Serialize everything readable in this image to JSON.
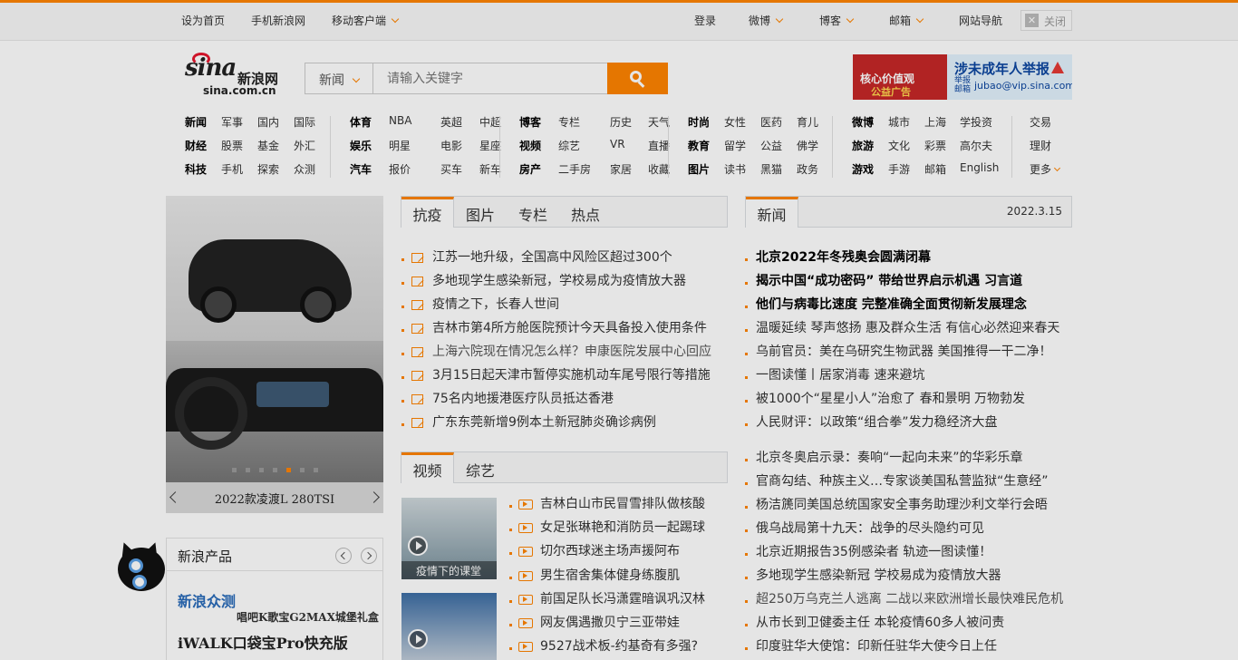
{
  "topbar": {
    "left_links": [
      "设为首页",
      "手机新浪网",
      "移动客户端"
    ],
    "right_links": [
      "登录",
      "微博",
      "博客",
      "邮箱",
      "网站导航"
    ],
    "close_label": "关闭"
  },
  "logo": {
    "brand": "sina",
    "cn": "新浪网",
    "domain": "sina.com.cn"
  },
  "search": {
    "category": "新闻",
    "placeholder": "请输入关键字"
  },
  "ad": {
    "left_line1": "核心价值观",
    "left_line2": "公益广告",
    "right_title": "涉未成年人举报",
    "right_small": "举报邮箱",
    "right_email": "jubao@vip.sina.com"
  },
  "nav": [
    [
      [
        "新闻",
        "军事",
        "国内",
        "国际"
      ],
      [
        "财经",
        "股票",
        "基金",
        "外汇"
      ],
      [
        "科技",
        "手机",
        "探索",
        "众测"
      ]
    ],
    [
      [
        "体育",
        "NBA",
        "英超",
        "中超"
      ],
      [
        "娱乐",
        "明星",
        "电影",
        "星座"
      ],
      [
        "汽车",
        "报价",
        "买车",
        "新车"
      ]
    ],
    [
      [
        "博客",
        "专栏",
        "历史",
        "天气"
      ],
      [
        "视频",
        "综艺",
        "VR",
        "直播"
      ],
      [
        "房产",
        "二手房",
        "家居",
        "收藏"
      ]
    ],
    [
      [
        "时尚",
        "女性",
        "医药",
        "育儿"
      ],
      [
        "教育",
        "留学",
        "公益",
        "佛学"
      ],
      [
        "图片",
        "读书",
        "黑猫",
        "政务"
      ]
    ],
    [
      [
        "微博",
        "城市",
        "上海",
        "学投资"
      ],
      [
        "旅游",
        "文化",
        "彩票",
        "高尔夫"
      ],
      [
        "游戏",
        "手游",
        "邮箱",
        "English"
      ]
    ],
    [
      [
        "交易"
      ],
      [
        "理财"
      ],
      [
        "更多"
      ]
    ]
  ],
  "carousel": {
    "caption": "2022款凌渡L 280TSI",
    "dot_count": 7,
    "active_dot": 5
  },
  "products": {
    "title": "新浪产品",
    "item1": "新浪众测",
    "item2": "唱吧K歌宝G2MAX城堡礼盒",
    "item3": "iWALK口袋宝Pro快充版"
  },
  "tabs_mid": [
    "抗疫",
    "图片",
    "专栏",
    "热点"
  ],
  "news_mid": [
    "江苏一地升级，全国高中风险区超过300个",
    "多地现学生感染新冠，学校易成为疫情放大器",
    "疫情之下，长春人世间",
    "吉林市第4所方舱医院预计今天具备投入使用条件",
    "上海六院现在情况怎么样？申康医院发展中心回应",
    "3月15日起天津市暂停实施机动车尾号限行等措施",
    "75名内地援港医疗队员抵达香港",
    "广东东莞新增9例本土新冠肺炎确诊病例"
  ],
  "tabs_video": [
    "视频",
    "综艺"
  ],
  "video_caption": "疫情下的课堂",
  "news_video": [
    "吉林白山市民冒雪排队做核酸",
    "女足张琳艳和消防员一起踢球",
    "切尔西球迷主场声援阿布",
    "男生宿舍集体健身练腹肌",
    "前国足队长冯潇霆暗讽巩汉林",
    "网友偶遇撒贝宁三亚带娃",
    "9527战术板-约基奇有多强?"
  ],
  "news_tab": "新闻",
  "news_date": "2022.3.15",
  "news_right_top": [
    "北京2022年冬残奥会圆满闭幕",
    "揭示中国“成功密码” 带给世界启示机遇 习言道",
    "他们与病毒比速度 完整准确全面贯彻新发展理念",
    "温暖延续 琴声悠扬 惠及群众生活 有信心必然迎来春天",
    "乌前官员：美在乌研究生物武器 美国推得一干二净！",
    "一图读懂丨居家消毒 速来避坑",
    "被1000个“星星小人”治愈了 春和景明 万物勃发",
    "人民财评：以政策“组合拳”发力稳经济大盘"
  ],
  "news_right_bottom": [
    "北京冬奥启示录：奏响“一起向未来”的华彩乐章",
    "官商勾结、种族主义…专家谈美国私营监狱“生意经”",
    "杨洁篪同美国总统国家安全事务助理沙利文举行会晤",
    "俄乌战局第十九天：战争的尽头隐约可见",
    "北京近期报告35例感染者 轨迹一图读懂！",
    "多地现学生感染新冠 学校易成为疫情放大器",
    "超250万乌克兰人逃离 二战以来欧洲增长最快难民危机",
    "从市长到卫健委主任 本轮疫情60多人被问责",
    "印度驻华大使馆：印新任驻华大使今日上任"
  ],
  "colors": {
    "accent": "#ff8400",
    "link_blue": "#2a6bb9"
  }
}
